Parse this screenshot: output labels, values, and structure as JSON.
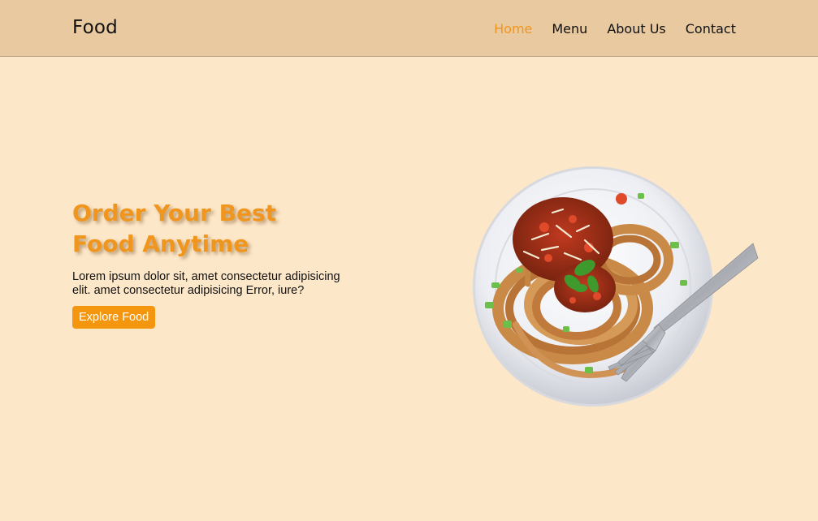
{
  "navbar": {
    "logo": "Food",
    "links": [
      {
        "label": "Home",
        "active": true
      },
      {
        "label": "Menu",
        "active": false
      },
      {
        "label": "About Us",
        "active": false
      },
      {
        "label": "Contact",
        "active": false
      }
    ]
  },
  "hero": {
    "title_line1": "Order Your Best",
    "title_line2": "Food Anytime",
    "description": "Lorem ipsum dolor sit, amet consectetur adipisicing elit. amet consectetur adipisicing Error, iure?",
    "cta_label": "Explore Food"
  },
  "colors": {
    "accent": "#f0961e",
    "nav_background": "#e8c9a0",
    "page_background": "#fde7c9"
  }
}
